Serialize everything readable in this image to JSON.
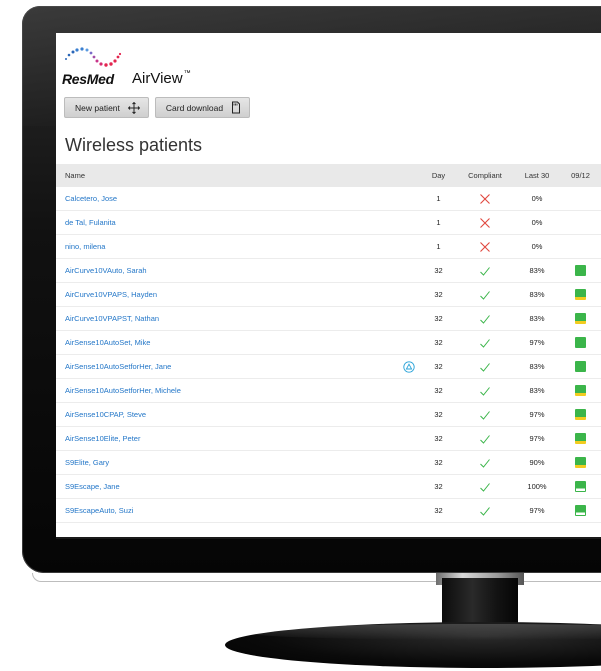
{
  "brand": {
    "company": "ResMed",
    "product": "AirView",
    "trademark": "™"
  },
  "colors": {
    "link_blue": "#2477c8",
    "compliant_green": "#3bb54a",
    "noncompliant_red": "#e0473e",
    "usage_yellow": "#f2cc1f",
    "flag_blue": "#2aa3d8"
  },
  "toolbar": {
    "new_patient_label": "New patient",
    "new_patient_icon": "move-arrows-icon",
    "card_download_label": "Card download",
    "card_download_icon": "sd-card-icon"
  },
  "page": {
    "title": "Wireless patients"
  },
  "table": {
    "headers": {
      "name": "Name",
      "day": "Day",
      "compliant": "Compliant",
      "last30": "Last 30",
      "date": "09/12"
    },
    "rows": [
      {
        "name": "Calcetero, Jose",
        "flag": false,
        "day": "1",
        "compliant": false,
        "last30": "0%",
        "usage": "none"
      },
      {
        "name": "de Tal, Fulanita",
        "flag": false,
        "day": "1",
        "compliant": false,
        "last30": "0%",
        "usage": "none"
      },
      {
        "name": "nino, milena",
        "flag": false,
        "day": "1",
        "compliant": false,
        "last30": "0%",
        "usage": "none"
      },
      {
        "name": "AirCurve10VAuto, Sarah",
        "flag": false,
        "day": "32",
        "compliant": true,
        "last30": "83%",
        "usage": "full"
      },
      {
        "name": "AirCurve10VPAPS, Hayden",
        "flag": false,
        "day": "32",
        "compliant": true,
        "last30": "83%",
        "usage": "yellow"
      },
      {
        "name": "AirCurve10VPAPST, Nathan",
        "flag": false,
        "day": "32",
        "compliant": true,
        "last30": "83%",
        "usage": "yellow"
      },
      {
        "name": "AirSense10AutoSet, Mike",
        "flag": false,
        "day": "32",
        "compliant": true,
        "last30": "97%",
        "usage": "full"
      },
      {
        "name": "AirSense10AutoSetforHer, Jane",
        "flag": true,
        "day": "32",
        "compliant": true,
        "last30": "83%",
        "usage": "full"
      },
      {
        "name": "AirSense10AutoSetforHer, Michele",
        "flag": false,
        "day": "32",
        "compliant": true,
        "last30": "83%",
        "usage": "yellow"
      },
      {
        "name": "AirSense10CPAP, Steve",
        "flag": false,
        "day": "32",
        "compliant": true,
        "last30": "97%",
        "usage": "yellow"
      },
      {
        "name": "AirSense10Elite, Peter",
        "flag": false,
        "day": "32",
        "compliant": true,
        "last30": "97%",
        "usage": "yellow"
      },
      {
        "name": "S9Elite, Gary",
        "flag": false,
        "day": "32",
        "compliant": true,
        "last30": "90%",
        "usage": "yellow"
      },
      {
        "name": "S9Escape, Jane",
        "flag": false,
        "day": "32",
        "compliant": true,
        "last30": "100%",
        "usage": "white"
      },
      {
        "name": "S9EscapeAuto, Suzi",
        "flag": false,
        "day": "32",
        "compliant": true,
        "last30": "97%",
        "usage": "white"
      }
    ]
  }
}
